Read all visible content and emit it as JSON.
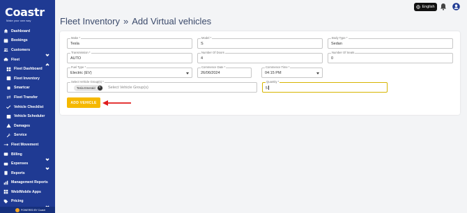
{
  "app": {
    "logo_text": "Coastr",
    "logo_tagline": "Make your own way",
    "powered_by": "POWERED BY Coastr"
  },
  "sidebar": {
    "items": [
      {
        "label": "Dashboard",
        "icon": "home-icon",
        "sub": false,
        "chevron": ""
      },
      {
        "label": "Bookings",
        "icon": "calendar-icon",
        "sub": false,
        "chevron": ""
      },
      {
        "label": "Customers",
        "icon": "users-icon",
        "sub": false,
        "chevron": "down"
      },
      {
        "label": "Fleet",
        "icon": "car-icon",
        "sub": false,
        "chevron": "up"
      },
      {
        "label": "Fleet Dashboard",
        "icon": "dashboard-icon",
        "sub": true,
        "chevron": ""
      },
      {
        "label": "Fleet Inventory",
        "icon": "list-icon",
        "sub": true,
        "chevron": ""
      },
      {
        "label": "Smartcar",
        "icon": "chip-icon",
        "sub": true,
        "chevron": ""
      },
      {
        "label": "Fleet Transfer",
        "icon": "transfer-icon",
        "sub": true,
        "chevron": ""
      },
      {
        "label": "Vehicle Checklist",
        "icon": "checklist-icon",
        "sub": true,
        "chevron": ""
      },
      {
        "label": "Vehicle Scheduler",
        "icon": "scheduler-icon",
        "sub": true,
        "chevron": ""
      },
      {
        "label": "Damages",
        "icon": "warning-icon",
        "sub": true,
        "chevron": ""
      },
      {
        "label": "Service",
        "icon": "wrench-icon",
        "sub": true,
        "chevron": ""
      },
      {
        "label": "Fleet Movement",
        "icon": "movement-icon",
        "sub": false,
        "chevron": ""
      },
      {
        "label": "Billing",
        "icon": "billing-icon",
        "sub": false,
        "chevron": "down"
      },
      {
        "label": "Expenses",
        "icon": "wallet-icon",
        "sub": false,
        "chevron": "down"
      },
      {
        "label": "Reports",
        "icon": "report-icon",
        "sub": false,
        "chevron": ""
      },
      {
        "label": "Management Reports",
        "icon": "chart-icon",
        "sub": false,
        "chevron": ""
      },
      {
        "label": "Web/Mobile Apps",
        "icon": "apps-icon",
        "sub": false,
        "chevron": ""
      },
      {
        "label": "Pricing",
        "icon": "tag-icon",
        "sub": false,
        "chevron": "down"
      }
    ]
  },
  "topbar": {
    "language": "English",
    "language_icon": "globe-icon",
    "bell_icon": "bell-icon",
    "user_icon": "user-icon"
  },
  "breadcrumb": {
    "parent": "Fleet Inventory",
    "separator": "»",
    "current": "Add Virtual vehicles"
  },
  "form": {
    "make": {
      "label": "Make *",
      "value": "Tesla"
    },
    "model": {
      "label": "Model *",
      "value": "S"
    },
    "body_type": {
      "label": "Body Type *",
      "value": "Sedan"
    },
    "transmission": {
      "label": "Transmission *",
      "value": "AUTO"
    },
    "doors": {
      "label": "Number Of Doors",
      "value": "4"
    },
    "seats": {
      "label": "Number Of Seats",
      "value": "0"
    },
    "fuel_type": {
      "label": "Fuel Type *",
      "value": "Electric (EV)"
    },
    "commence_date": {
      "label": "Commence Date *",
      "value": "26/06/2024"
    },
    "commence_time": {
      "label": "Commence Time *",
      "value": "04:15 PM"
    },
    "vehicle_group": {
      "label": "Select Vehicle Group(s) *",
      "chip": "Tesla Emerald",
      "placeholder": "Select Vehicle Group(s)"
    },
    "quantity": {
      "label": "Quantity *",
      "value": "5"
    },
    "submit_label": "ADD VEHICLE"
  },
  "colors": {
    "sidebar": "#1f3a93",
    "accent": "#f5b800",
    "arrow": "#e01b1b"
  }
}
